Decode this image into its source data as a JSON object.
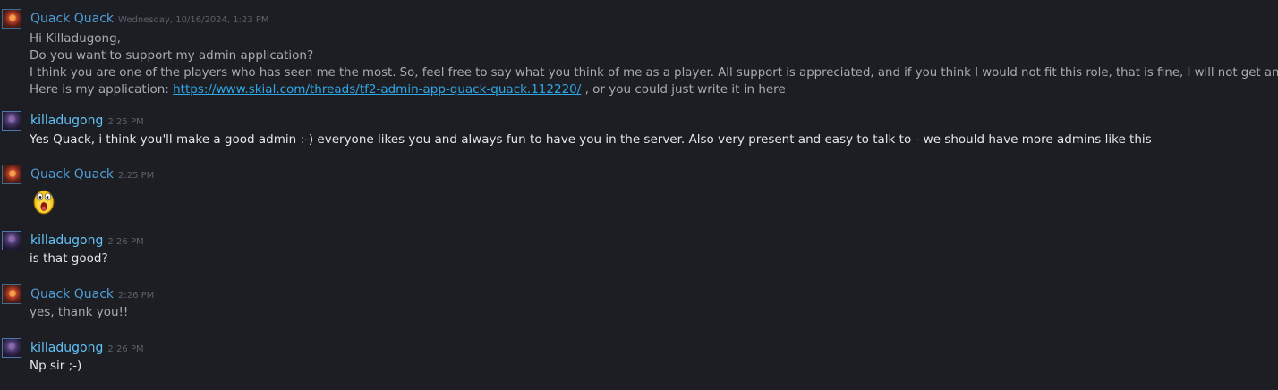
{
  "messages": [
    {
      "author": "Quack Quack",
      "timestamp": "Wednesday, 10/16/2024, 1:23 PM",
      "lines": {
        "l1": "Hi Killadugong,",
        "l2": "Do you want to support my admin application?",
        "l3": "I think you are one of the players who has seen me the most. So, feel free to say what you think of me as a player. All support is appreciated, and if you think I would not fit this role, that is fine, I will not get angry.",
        "l4_prefix": "Here is my application: ",
        "l4_link": "https://www.skial.com/threads/tf2-admin-app-quack-quack.112220/",
        "l4_suffix": " , or you could just write it in here"
      }
    },
    {
      "author": "killadugong",
      "timestamp": "2:25 PM",
      "text": "Yes Quack, i think you'll make a good admin :-) everyone likes you and always fun to have you in the server. Also very present and easy to talk to - we should have more admins like this"
    },
    {
      "author": "Quack Quack",
      "timestamp": "2:25 PM",
      "emote": "surprised-face-emoticon"
    },
    {
      "author": "killadugong",
      "timestamp": "2:26 PM",
      "text": "is that good?"
    },
    {
      "author": "Quack Quack",
      "timestamp": "2:26 PM",
      "text": "yes, thank you!!"
    },
    {
      "author": "killadugong",
      "timestamp": "2:26 PM",
      "text": "Np sir ;-)"
    }
  ],
  "colors": {
    "background": "#1d1e24",
    "quack_name": "#4e9dd4",
    "killa_name": "#62c1f5",
    "link": "#2ea8e8"
  }
}
